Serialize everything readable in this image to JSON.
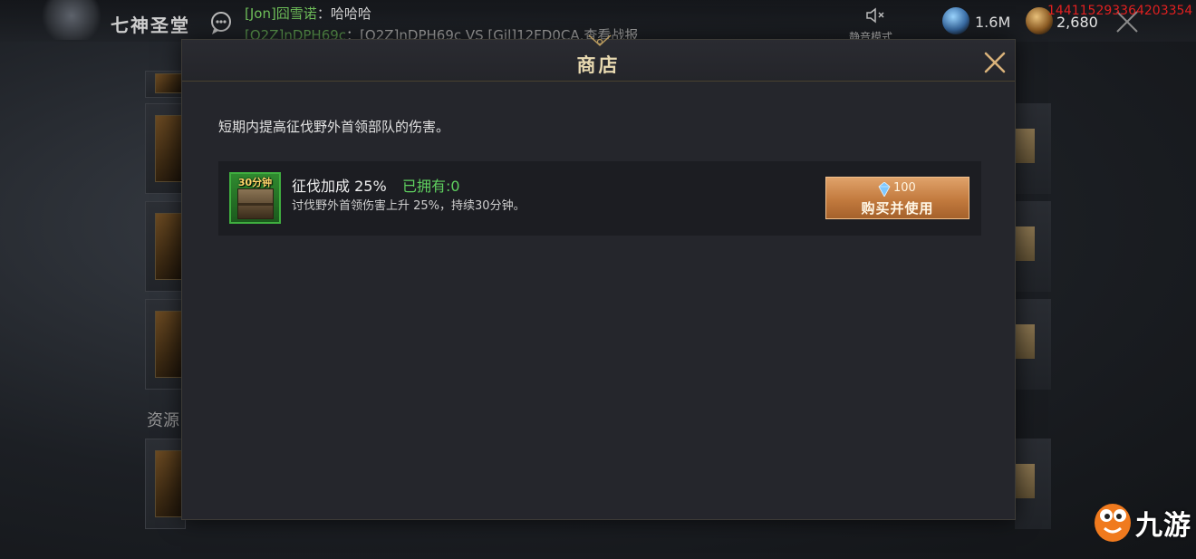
{
  "watermark_id": "144115293364203354",
  "top_bar": {
    "hall_title": "七神圣堂",
    "chat": [
      {
        "sender": "[Jon]囧雪诺",
        "separator": "：",
        "message": "哈哈哈"
      },
      {
        "sender": "[Q2Z]nDPH69c",
        "separator": "：",
        "message": "[Q2Z]nDPH69c VS [Gil]12FD0CA,查看战报"
      }
    ],
    "mute_label": "静音模式",
    "gem_value": "1.6M",
    "gold_value": "2,680"
  },
  "background": {
    "section_label": "资源"
  },
  "modal": {
    "title": "商店",
    "description": "短期内提高征伐野外首领部队的伤害。",
    "item": {
      "duration_badge": "30分钟",
      "name": "征伐加成 25%",
      "owned": "已拥有:0",
      "effect": "讨伐野外首领伤害上升 25%，持续30分钟。",
      "price": "100",
      "buy_label": "购买并使用"
    }
  },
  "site_logo": {
    "text": "九游"
  },
  "colors": {
    "owned_green": "#5fd05f",
    "chat_sender_green": "#6fbf5a",
    "button_orange": "#c27a3e",
    "watermark_red": "#e02020"
  }
}
